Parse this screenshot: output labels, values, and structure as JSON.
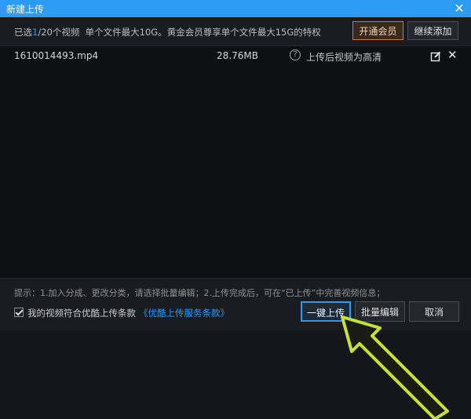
{
  "dialog": {
    "title": "新建上传",
    "close_glyph": "✕"
  },
  "info": {
    "selected_prefix": "已选",
    "selected_count": "1",
    "selected_suffix": "/20个视频",
    "limit_text": "单个文件最大10G。黄金会员尊享单个文件最大15G的特权"
  },
  "buttons": {
    "vip": "开通会员",
    "continue_add": "继续添加",
    "upload_all": "一键上传",
    "batch_edit": "批量编辑",
    "cancel": "取消"
  },
  "files": [
    {
      "name": "1610014493.mp4",
      "size": "28.76MB",
      "help_glyph": "?",
      "quality": "上传后视频为高清",
      "remove_glyph": "✕"
    }
  ],
  "footer": {
    "tip": "提示：1.加入分成、更改分类，请选择批量编辑；2.上传完成后，可在“已上传”中完善视频信息；",
    "agree_text": "我的视频符合优酷上传条款",
    "agree_link": "《优酷上传服务条款》",
    "agree_checked": true
  },
  "colors": {
    "accent": "#2b9bf4",
    "arrow": "#c6e03a",
    "vip_border": "#c27a3e"
  },
  "icons": [
    "close-icon",
    "help-icon",
    "edit-icon",
    "remove-icon",
    "checkbox-icon"
  ]
}
